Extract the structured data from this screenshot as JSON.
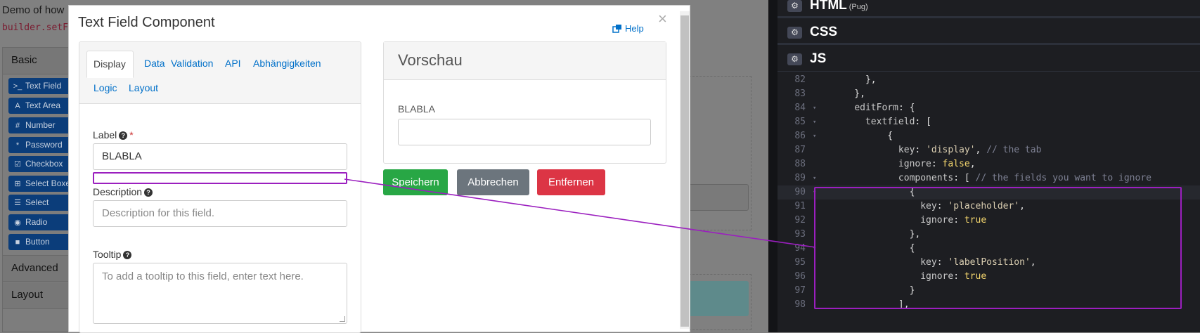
{
  "background": {
    "intro": "Demo of how",
    "code": "builder.setFo",
    "groups": [
      "Basic",
      "Advanced",
      "Layout"
    ],
    "buttons": [
      {
        "icon": ">_",
        "label": "Text Field"
      },
      {
        "icon": "A",
        "label": "Text Area"
      },
      {
        "icon": "#",
        "label": "Number"
      },
      {
        "icon": "*",
        "label": "Password"
      },
      {
        "icon": "☑",
        "label": "Checkbox"
      },
      {
        "icon": "⊞",
        "label": "Select Boxes"
      },
      {
        "icon": "☰",
        "label": "Select"
      },
      {
        "icon": "◉",
        "label": "Radio"
      },
      {
        "icon": "■",
        "label": "Button"
      }
    ]
  },
  "modal": {
    "title": "Text Field Component",
    "close": "×",
    "help": "Help",
    "tabs": [
      "Display",
      "Data",
      "Validation",
      "API",
      "Abhängigkeiten",
      "Logic",
      "Layout"
    ],
    "fields": {
      "label": {
        "label": "Label",
        "required": "*",
        "value": "BLABLA"
      },
      "description": {
        "label": "Description",
        "placeholder": "Description for this field."
      },
      "tooltip": {
        "label": "Tooltip",
        "placeholder": "To add a tooltip to this field, enter text here."
      }
    },
    "preview": {
      "title": "Vorschau",
      "field_label": "BLABLA"
    },
    "buttons": {
      "save": "Speichern",
      "cancel": "Abbrechen",
      "remove": "Entfernen"
    }
  },
  "editor": {
    "panels": [
      {
        "name": "HTML",
        "sub": "(Pug)"
      },
      {
        "name": "CSS",
        "sub": ""
      },
      {
        "name": "JS",
        "sub": ""
      }
    ],
    "lines": [
      {
        "n": "82",
        "fold": "",
        "code": "      },"
      },
      {
        "n": "83",
        "fold": "",
        "code": "    },"
      },
      {
        "n": "84",
        "fold": "▾",
        "code": "    editForm: {"
      },
      {
        "n": "85",
        "fold": "▾",
        "code": "      textfield: ["
      },
      {
        "n": "86",
        "fold": "▾",
        "code": "          {"
      },
      {
        "n": "87",
        "fold": "",
        "code": "            key: 'display', // the tab"
      },
      {
        "n": "88",
        "fold": "",
        "code": "            ignore: false,"
      },
      {
        "n": "89",
        "fold": "▾",
        "code": "            components: [ // the fields you want to ignore"
      },
      {
        "n": "90",
        "fold": "▾",
        "code": "              {"
      },
      {
        "n": "91",
        "fold": "",
        "code": "                key: 'placeholder',"
      },
      {
        "n": "92",
        "fold": "",
        "code": "                ignore: true"
      },
      {
        "n": "93",
        "fold": "",
        "code": "              },"
      },
      {
        "n": "94",
        "fold": "▾",
        "code": "              {"
      },
      {
        "n": "95",
        "fold": "",
        "code": "                key: 'labelPosition',"
      },
      {
        "n": "96",
        "fold": "",
        "code": "                ignore: true"
      },
      {
        "n": "97",
        "fold": "",
        "code": "              }"
      },
      {
        "n": "98",
        "fold": "",
        "code": "            ],"
      }
    ]
  },
  "colors": {
    "save": "#28a745",
    "cancel": "#6c757d",
    "remove": "#dc3545",
    "annotation": "#9b1fbf",
    "link": "#0070c9"
  }
}
